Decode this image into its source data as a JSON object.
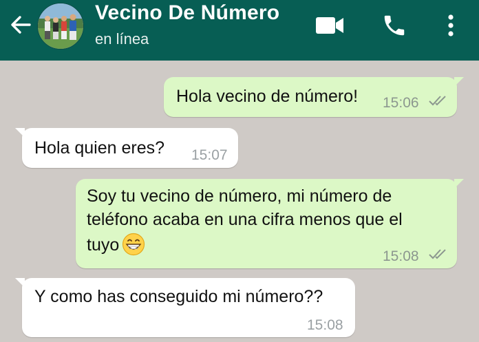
{
  "header": {
    "contact_name": "Vecino De Número",
    "status": "en línea",
    "icons": [
      "back-arrow-icon",
      "video-call-icon",
      "phone-icon",
      "more-vertical-icon"
    ]
  },
  "colors": {
    "header_bg": "#075e54",
    "chat_bg": "#cfcac6",
    "outgoing_bubble": "#dcf8c6",
    "incoming_bubble": "#ffffff",
    "read_ticks": "#8c978f"
  },
  "messages": [
    {
      "direction": "outgoing",
      "lines": [
        "Hola vecino de número!"
      ],
      "time": "15:06",
      "ticks": "double-check"
    },
    {
      "direction": "incoming",
      "lines": [
        "Hola quien eres?"
      ],
      "time": "15:07"
    },
    {
      "direction": "outgoing",
      "lines": [
        "Soy tu vecino de número, mi número de",
        "teléfono acaba en una cifra menos que el",
        "tuyo"
      ],
      "emoji": "grinning-face-icon",
      "time": "15:08",
      "ticks": "double-check"
    },
    {
      "direction": "incoming",
      "lines": [
        "Y como has conseguido mi número??"
      ],
      "time": "15:08"
    }
  ]
}
